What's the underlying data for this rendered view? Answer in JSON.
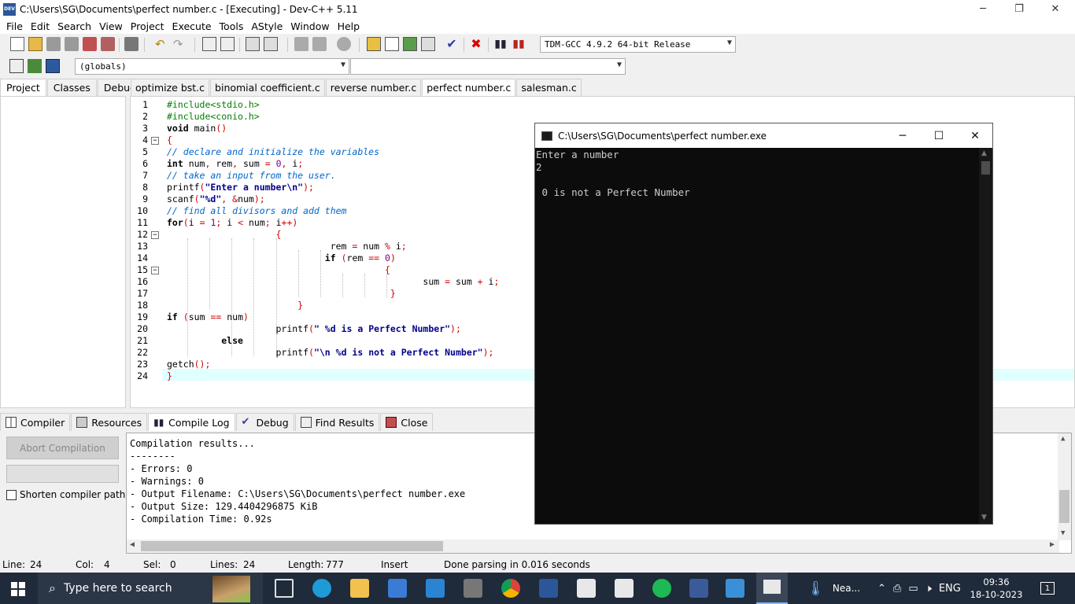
{
  "window": {
    "title": "C:\\Users\\SG\\Documents\\perfect number.c - [Executing] - Dev-C++ 5.11",
    "app_icon_label": "DEV",
    "controls": [
      "─",
      "❐",
      "✕"
    ]
  },
  "menu": [
    "File",
    "Edit",
    "Search",
    "View",
    "Project",
    "Execute",
    "Tools",
    "AStyle",
    "Window",
    "Help"
  ],
  "toolbar": {
    "compiler_select": "TDM-GCC 4.9.2 64-bit Release",
    "scope_select": "(globals)",
    "member_select": ""
  },
  "left_tabs": [
    "Project",
    "Classes",
    "Debug"
  ],
  "file_tabs": [
    "optimize bst.c",
    "binomial coefficient.c",
    "reverse number.c",
    "perfect number.c",
    "salesman.c"
  ],
  "editor": {
    "line_numbers": [
      "1",
      "2",
      "3",
      "4",
      "5",
      "6",
      "7",
      "8",
      "9",
      "10",
      "11",
      "12",
      "13",
      "14",
      "15",
      "16",
      "17",
      "18",
      "19",
      "20",
      "21",
      "22",
      "23",
      "24"
    ]
  },
  "bottom_tabs": [
    "Compiler",
    "Resources",
    "Compile Log",
    "Debug",
    "Find Results",
    "Close"
  ],
  "compile_panel": {
    "abort_button": "Abort Compilation",
    "shorten_paths_label": "Shorten compiler paths",
    "log": [
      "Compilation results...",
      "--------",
      "- Errors: 0",
      "- Warnings: 0",
      "- Output Filename: C:\\Users\\SG\\Documents\\perfect number.exe",
      "- Output Size: 129.4404296875 KiB",
      "- Compilation Time: 0.92s"
    ]
  },
  "status": {
    "line_label": "Line:",
    "line_value": "24",
    "col_label": "Col:",
    "col_value": "4",
    "sel_label": "Sel:",
    "sel_value": "0",
    "lines_label": "Lines:",
    "lines_value": "24",
    "length_label": "Length:",
    "length_value": "777",
    "mode": "Insert",
    "message": "Done parsing in 0.016 seconds"
  },
  "console": {
    "title": "C:\\Users\\SG\\Documents\\perfect number.exe",
    "lines": [
      "Enter a number",
      "2",
      "",
      " 0 is not a Perfect Number"
    ]
  },
  "taskbar": {
    "search_placeholder": "Type here to search",
    "weather": "Nea...",
    "language": "ENG",
    "time": "09:36",
    "date": "18-10-2023",
    "notification_count": "1"
  },
  "colors": {
    "taskbar_bg": "#1f2a3a",
    "console_bg": "#0c0c0c",
    "current_line": "#e0ffff",
    "keyword_string": "#00008b",
    "comment": "#0066cc",
    "symbol": "#d00000"
  }
}
